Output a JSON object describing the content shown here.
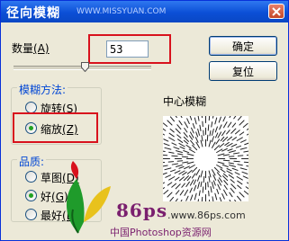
{
  "window": {
    "title": "径向模糊",
    "title_watermark": "WWW.MISSYUAN.COM"
  },
  "amount": {
    "label": "数量",
    "mnemonic": "(A)",
    "value": "53"
  },
  "blur_method": {
    "legend": "模糊方法:",
    "options": [
      {
        "label": "旋转",
        "mnemonic": "(S)",
        "checked": false
      },
      {
        "label": "缩放",
        "mnemonic": "(Z)",
        "checked": true
      }
    ]
  },
  "quality": {
    "legend": "品质:",
    "options": [
      {
        "label": "草图",
        "mnemonic": "(D)",
        "checked": false
      },
      {
        "label": "好",
        "mnemonic": "(G)",
        "checked": true
      },
      {
        "label": "最好",
        "mnemonic": "(B)",
        "checked": false
      }
    ]
  },
  "buttons": {
    "ok": "确定",
    "reset": "复位"
  },
  "preview": {
    "label": "中心模糊"
  },
  "watermark": {
    "brand": "86ps",
    "url": ".www.86ps.com",
    "text": "中国Photoshop资源网"
  },
  "colors": {
    "highlight": "#d8121d",
    "titlebar": "#0b4fd6",
    "group_legend": "#0046d5"
  }
}
